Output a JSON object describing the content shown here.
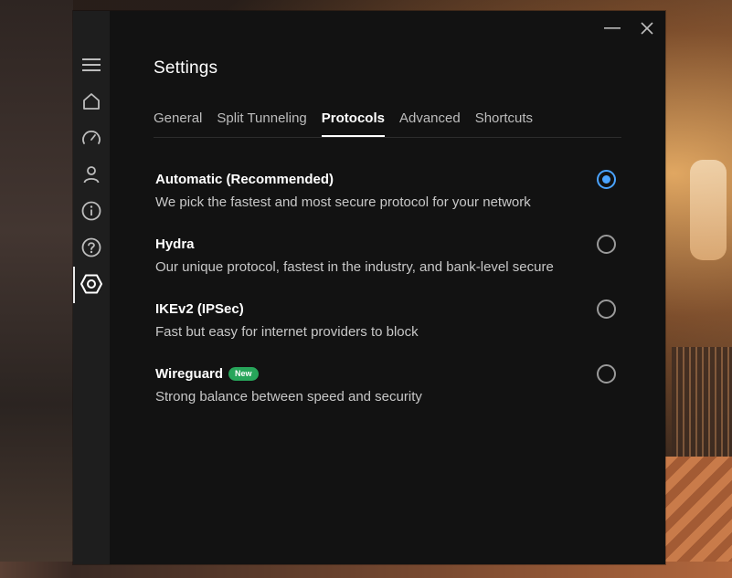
{
  "window": {
    "title": "Settings",
    "controls": [
      "minimize-icon",
      "close-icon"
    ]
  },
  "sidebar": {
    "items": [
      {
        "icon": "menu-icon"
      },
      {
        "icon": "home-icon"
      },
      {
        "icon": "speedometer-icon"
      },
      {
        "icon": "account-icon"
      },
      {
        "icon": "info-icon"
      },
      {
        "icon": "help-icon"
      },
      {
        "icon": "settings-icon",
        "active": true
      }
    ]
  },
  "tabs": [
    {
      "label": "General"
    },
    {
      "label": "Split Tunneling"
    },
    {
      "label": "Protocols",
      "active": true
    },
    {
      "label": "Advanced"
    },
    {
      "label": "Shortcuts"
    }
  ],
  "protocols": [
    {
      "title": "Automatic (Recommended)",
      "description": "We pick the fastest and most secure protocol for your network",
      "selected": true
    },
    {
      "title": "Hydra",
      "description": "Our unique protocol, fastest in the industry, and bank-level secure",
      "selected": false
    },
    {
      "title": "IKEv2 (IPSec)",
      "description": "Fast but easy for internet providers to block",
      "selected": false
    },
    {
      "title": "Wireguard",
      "badge": "New",
      "description": "Strong balance between speed and security",
      "selected": false
    }
  ],
  "colors": {
    "accent": "#4aa3ff",
    "badge": "#27a55a",
    "window_bg": "#121212",
    "sidebar_bg": "#1e1e1e"
  }
}
